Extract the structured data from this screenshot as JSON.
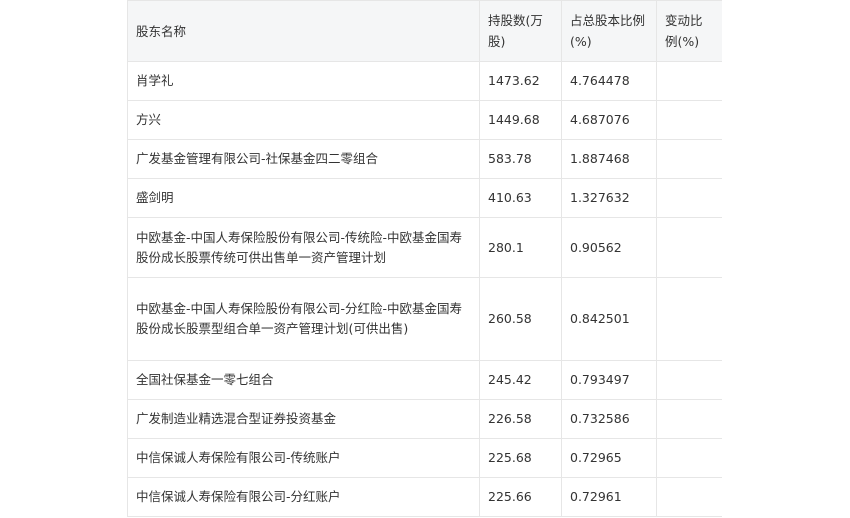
{
  "table": {
    "headers": {
      "name": "股东名称",
      "shares": "持股数(万股)",
      "pct": "占总股本比例(%)",
      "change": "变动比例(%)"
    },
    "rows": [
      {
        "name": "肖学礼",
        "shares": "1473.62",
        "pct": "4.764478",
        "change": ""
      },
      {
        "name": "方兴",
        "shares": "1449.68",
        "pct": "4.687076",
        "change": ""
      },
      {
        "name": "广发基金管理有限公司-社保基金四二零组合",
        "shares": "583.78",
        "pct": "1.887468",
        "change": ""
      },
      {
        "name": "盛剑明",
        "shares": "410.63",
        "pct": "1.327632",
        "change": ""
      },
      {
        "name": "中欧基金-中国人寿保险股份有限公司-传统险-中欧基金国寿股份成长股票传统可供出售单一资产管理计划",
        "shares": "280.1",
        "pct": "0.90562",
        "change": ""
      },
      {
        "name": "中欧基金-中国人寿保险股份有限公司-分红险-中欧基金国寿股份成长股票型组合单一资产管理计划(可供出售)",
        "shares": "260.58",
        "pct": "0.842501",
        "change": ""
      },
      {
        "name": "全国社保基金一零七组合",
        "shares": "245.42",
        "pct": "0.793497",
        "change": ""
      },
      {
        "name": "广发制造业精选混合型证券投资基金",
        "shares": "226.58",
        "pct": "0.732586",
        "change": ""
      },
      {
        "name": "中信保诚人寿保险有限公司-传统账户",
        "shares": "225.68",
        "pct": "0.72965",
        "change": ""
      },
      {
        "name": "中信保诚人寿保险有限公司-分红账户",
        "shares": "225.66",
        "pct": "0.72961",
        "change": ""
      }
    ]
  }
}
